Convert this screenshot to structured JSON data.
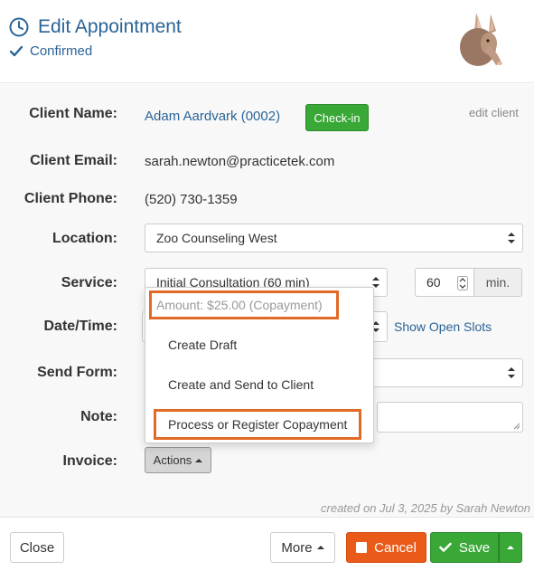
{
  "header": {
    "title": "Edit Appointment",
    "status": "Confirmed"
  },
  "client": {
    "name_label": "Client Name:",
    "name": "Adam Aardvark (0002)",
    "checkin_label": "Check-in",
    "edit_label": "edit client",
    "email_label": "Client Email:",
    "email": "sarah.newton@practicetek.com",
    "phone_label": "Client Phone:",
    "phone": "(520) 730-1359"
  },
  "form": {
    "location_label": "Location:",
    "location": "Zoo Counseling West",
    "service_label": "Service:",
    "service": "Initial Consultation (60 min)",
    "duration": "60",
    "duration_unit": "min.",
    "datetime_label": "Date/Time:",
    "show_slots": "Show Open Slots",
    "send_form_label": "Send Form:",
    "note_label": "Note:",
    "invoice_label": "Invoice:",
    "actions_label": "Actions"
  },
  "dropdown": {
    "amount": "Amount: $25.00 (Copayment)",
    "items": [
      "Create Draft",
      "Create and Send to Client",
      "Process or Register Copayment"
    ]
  },
  "meta": {
    "created": "created on Jul 3, 2025 by Sarah Newton"
  },
  "footer": {
    "close": "Close",
    "more": "More",
    "cancel": "Cancel",
    "save": "Save"
  },
  "colors": {
    "accent_blue": "#2a6496",
    "green": "#3aa836",
    "orange": "#ea5a18",
    "highlight": "#e06a26"
  }
}
